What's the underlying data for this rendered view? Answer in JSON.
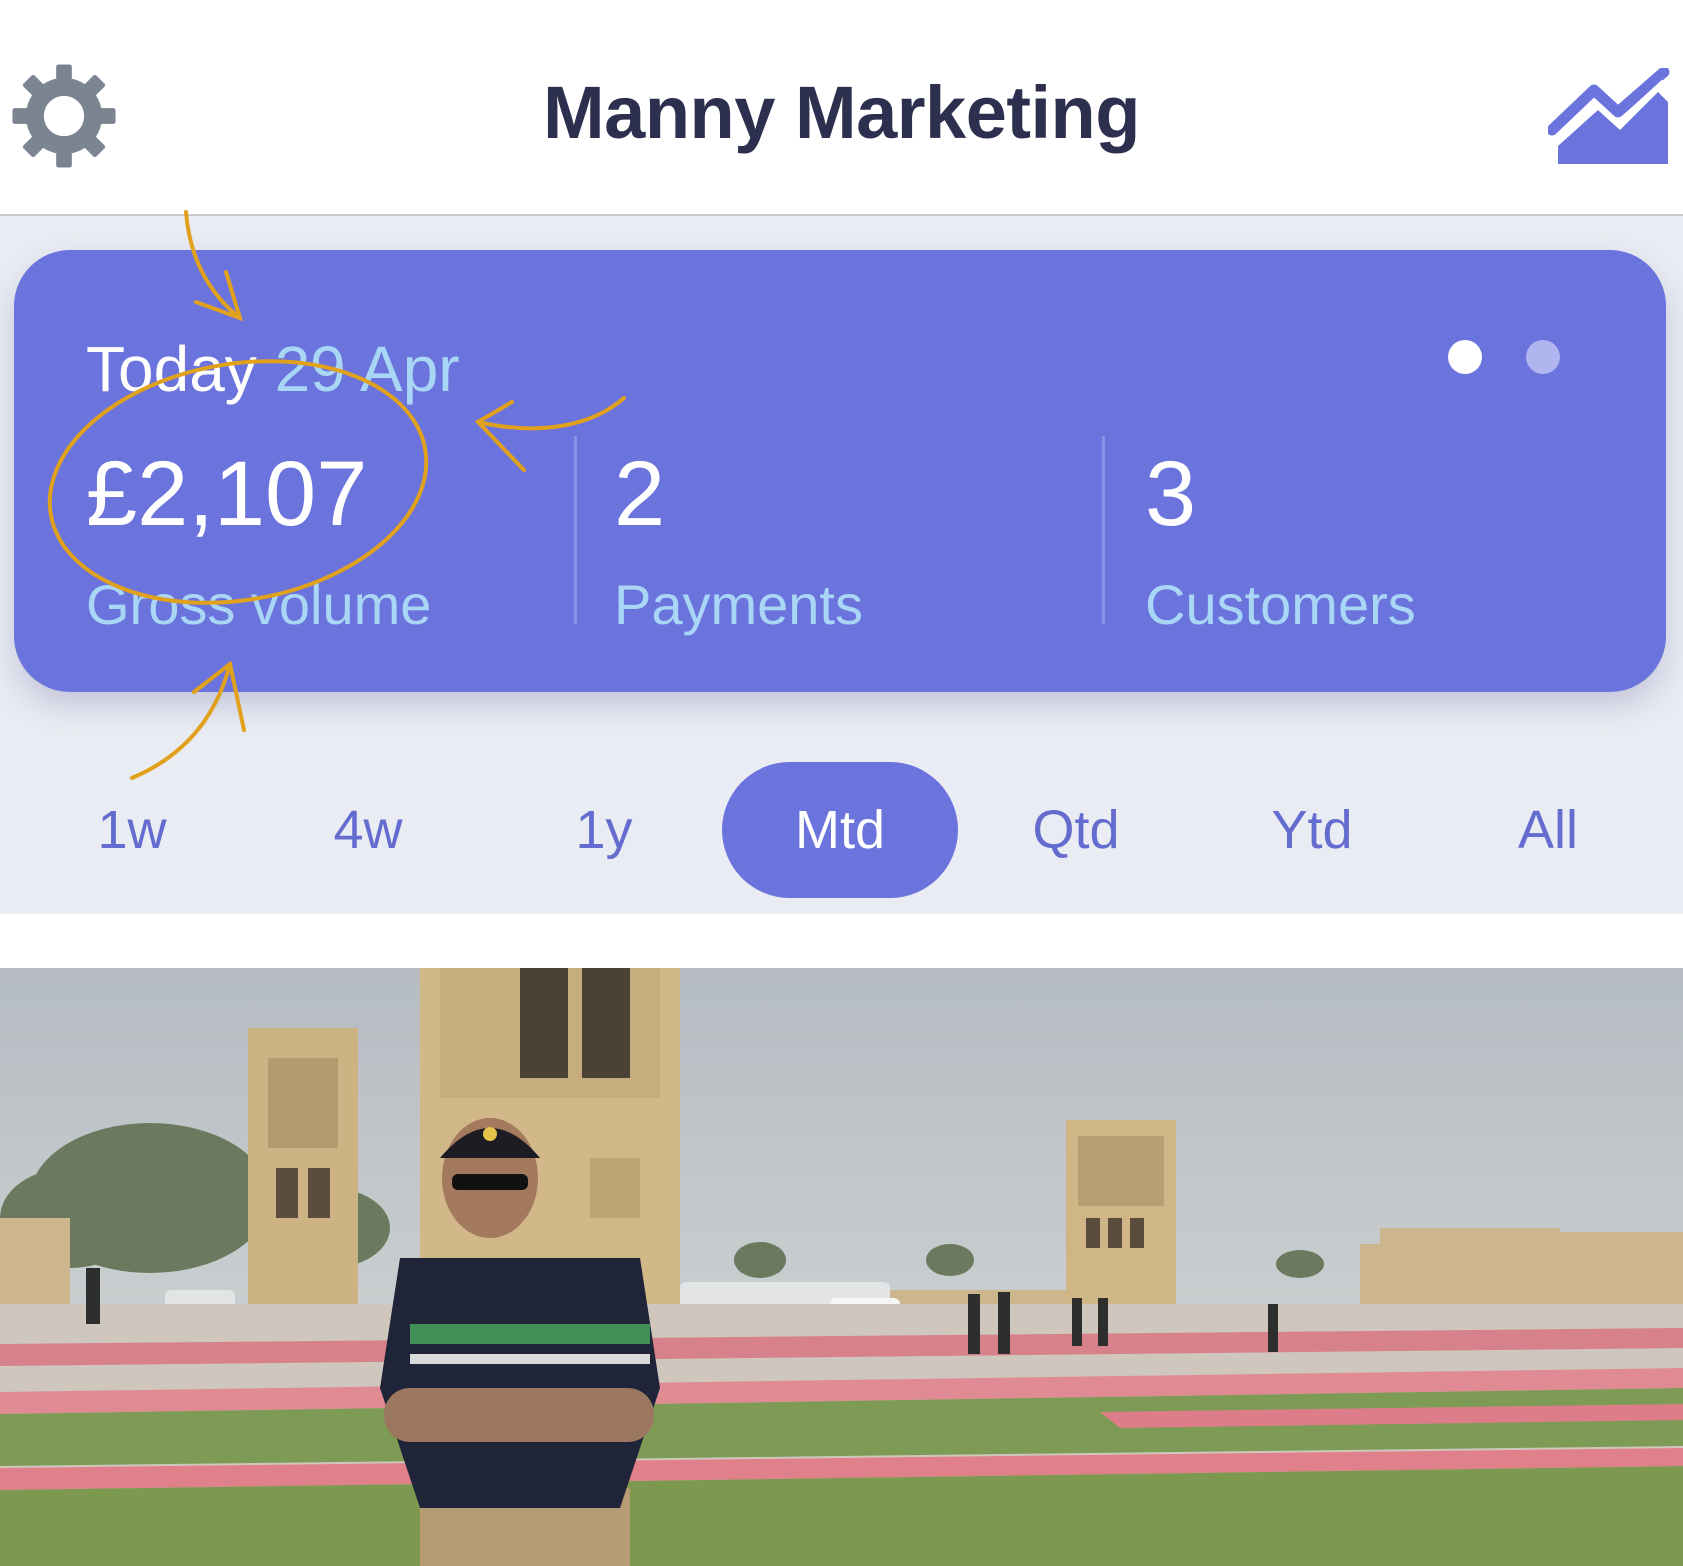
{
  "header": {
    "title": "Manny Marketing",
    "left_icon": "gear-icon",
    "right_icon": "trend-chart-icon"
  },
  "card": {
    "today_label": "Today",
    "date": "29 Apr",
    "page_dots": {
      "count": 2,
      "active_index": 0
    },
    "stats": [
      {
        "value": "£2,107",
        "label": "Gross volume"
      },
      {
        "value": "2",
        "label": "Payments"
      },
      {
        "value": "3",
        "label": "Customers"
      }
    ]
  },
  "periods": {
    "items": [
      "1w",
      "4w",
      "1y",
      "Mtd",
      "Qtd",
      "Ytd",
      "All"
    ],
    "selected": "Mtd"
  },
  "photo": {
    "subject": "person-in-cap-arms-crossed",
    "scene": "plaza-with-wind-towers"
  },
  "colors": {
    "accent": "#6b73dc",
    "title_text": "#2c2f4d",
    "label_blue": "#a9d6f5",
    "background": "#eaecf3",
    "annotation": "#e0a21c"
  }
}
